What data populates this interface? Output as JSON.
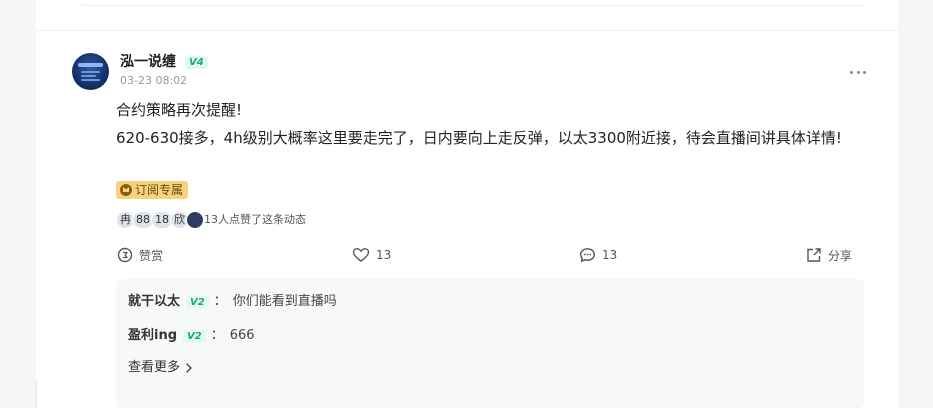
{
  "post": {
    "author": "泓一说缠",
    "level": "V4",
    "time": "03-23 08:02",
    "title": "合约策略再次提醒!",
    "body": "620-630接多，4h级别大概率这里要走完了，日内要向上走反弹，以太3300附近接，待会直播间讲具体详情!",
    "subscription_badge": "订阅专属",
    "likers": [
      "冉",
      "88",
      "18",
      "欣"
    ],
    "likes_text": "13人点赞了这条动态"
  },
  "actions": {
    "reward_label": "赞赏",
    "like_count": "13",
    "comment_count": "13",
    "share_label": "分享"
  },
  "comments": [
    {
      "name": "就干以太",
      "level": "V2",
      "sep": "：",
      "text": "你们能看到直播吗"
    },
    {
      "name": "盈利ing",
      "level": "V2",
      "sep": "：",
      "text": "666"
    }
  ],
  "view_more_label": "查看更多",
  "colors": {
    "level_badge": "#1aa87a",
    "subscription_badge_bg": "#f6d37c",
    "comment_box_bg": "#f7f8fa"
  },
  "icons": [
    "more-icon",
    "reward-icon",
    "heart-icon",
    "comment-icon",
    "share-icon",
    "chevron-right-icon",
    "crown-icon"
  ]
}
